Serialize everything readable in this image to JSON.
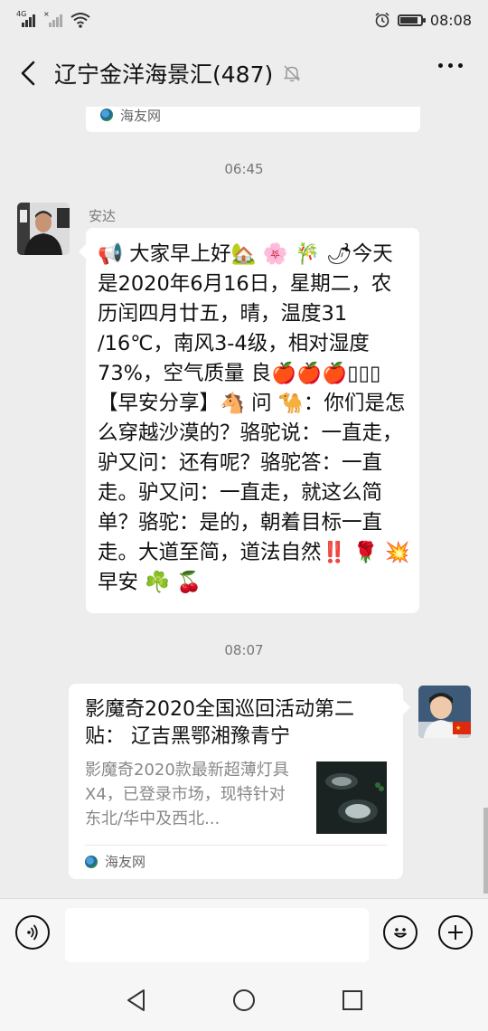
{
  "status_bar": {
    "network_1": "4G",
    "network_2": "×",
    "time": "08:08",
    "icons": [
      "signal-4g-icon",
      "signal-empty-icon",
      "wifi-icon",
      "alarm-icon",
      "battery-icon"
    ]
  },
  "header": {
    "title": "辽宁金洋海景汇(487)",
    "icons": [
      "back-arrow-icon",
      "mute-bell-icon",
      "more-dots-icon"
    ]
  },
  "messages": {
    "prev_card_source": "海友网",
    "time_1": "06:45",
    "sender_name": "安达",
    "text_message": "📢 大家早上好🏡 🌸 🎋 🌶今天是2020年6月16日，星期二，农历闰四月廿五，晴，温度31 /16℃，南风3-4级，相对湿度73%，空气质量 良🍎🍎🍎▯▯▯【早安分享】🐴 问 🐪：你们是怎么穿越沙漠的？骆驼说：一直走，驴又问：还有呢？骆驼答：一直走。驴又问：一直走，就这么简单？骆驼：是的，朝着目标一直走。大道至简，道法自然‼️ 🌹 💥早安 ☘️ 🍒",
    "time_2": "08:07",
    "link_card": {
      "title": "影魔奇2020全国巡回活动第二贴： 辽吉黑鄂湘豫青宁",
      "description": "影魔奇2020款最新超薄灯具X4，已登录市场，现特针对东北/华中及西北...",
      "source": "海友网"
    }
  },
  "input_bar": {
    "placeholder": "",
    "icons": [
      "voice-icon",
      "emoji-icon",
      "plus-icon"
    ]
  },
  "nav_bar": {
    "icons": [
      "nav-back-icon",
      "nav-home-icon",
      "nav-recents-icon"
    ]
  },
  "colors": {
    "background": "#ededed",
    "bubble": "#ffffff",
    "bar": "#f6f6f6"
  }
}
